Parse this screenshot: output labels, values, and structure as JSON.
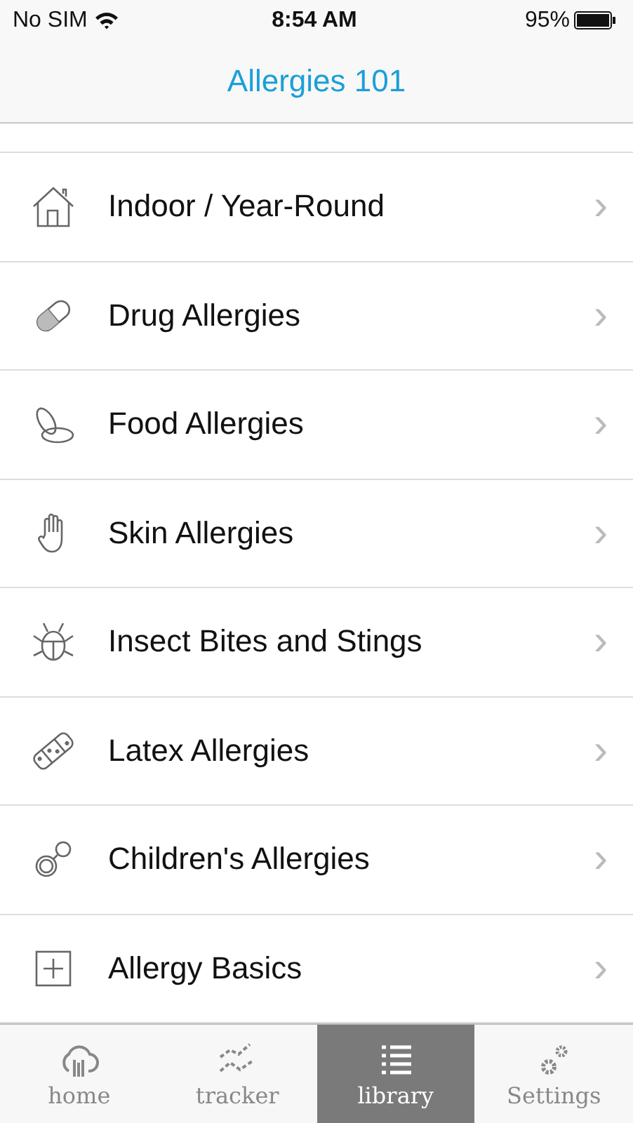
{
  "status_bar": {
    "carrier": "No SIM",
    "time": "8:54 AM",
    "battery": "95%"
  },
  "nav": {
    "title": "Allergies 101"
  },
  "items": [
    {
      "label": "Indoor / Year-Round",
      "chevron": "›"
    },
    {
      "label": "Drug Allergies",
      "chevron": "›"
    },
    {
      "label": "Food Allergies",
      "chevron": "›"
    },
    {
      "label": "Skin Allergies",
      "chevron": "›"
    },
    {
      "label": "Insect Bites and Stings",
      "chevron": "›"
    },
    {
      "label": "Latex Allergies",
      "chevron": "›"
    },
    {
      "label": "Children's Allergies",
      "chevron": "›"
    },
    {
      "label": "Allergy Basics",
      "chevron": "›"
    }
  ],
  "tabs": [
    {
      "label": "home",
      "selected": false
    },
    {
      "label": "tracker",
      "selected": false
    },
    {
      "label": "library",
      "selected": true
    },
    {
      "label": "Settings",
      "selected": false
    }
  ]
}
